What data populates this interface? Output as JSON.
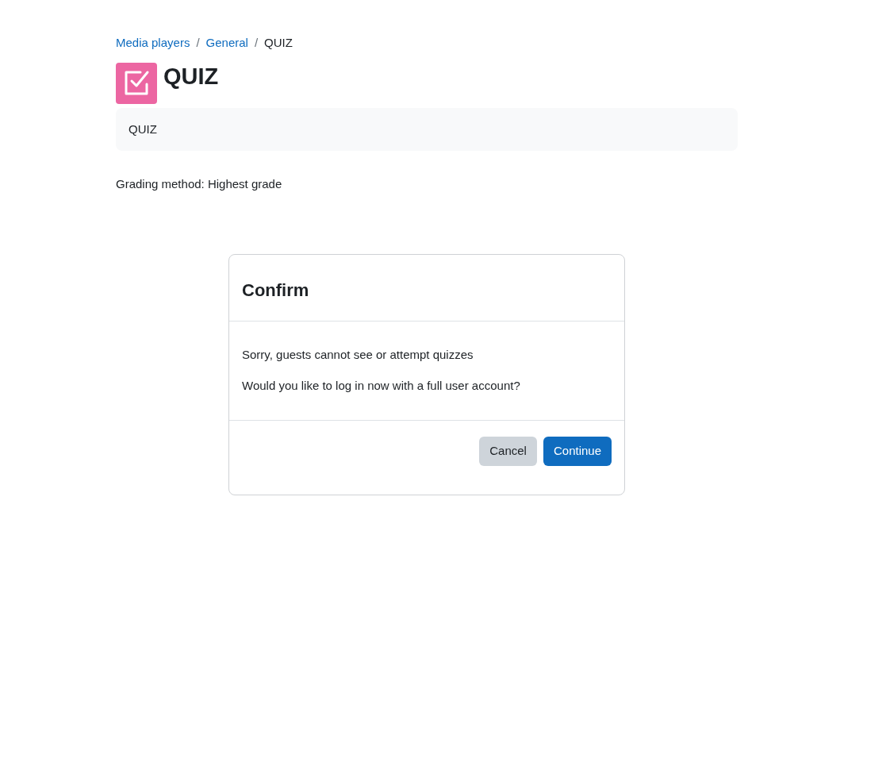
{
  "breadcrumb": [
    {
      "label": "Media players",
      "kind": "link"
    },
    {
      "label": "/",
      "kind": "separator"
    },
    {
      "label": "General",
      "kind": "link"
    },
    {
      "label": "/",
      "kind": "separator"
    },
    {
      "label": "QUIZ",
      "kind": "current"
    }
  ],
  "page": {
    "title": "QUIZ",
    "intro": "QUIZ",
    "grading": "Grading method: Highest grade"
  },
  "dialog": {
    "title": "Confirm",
    "messages": [
      "Sorry, guests cannot see or attempt quizzes",
      "Would you like to log in now with a full user account?"
    ],
    "buttons": [
      {
        "label": "Cancel",
        "kind": "secondary"
      },
      {
        "label": "Continue",
        "kind": "primary"
      }
    ]
  }
}
